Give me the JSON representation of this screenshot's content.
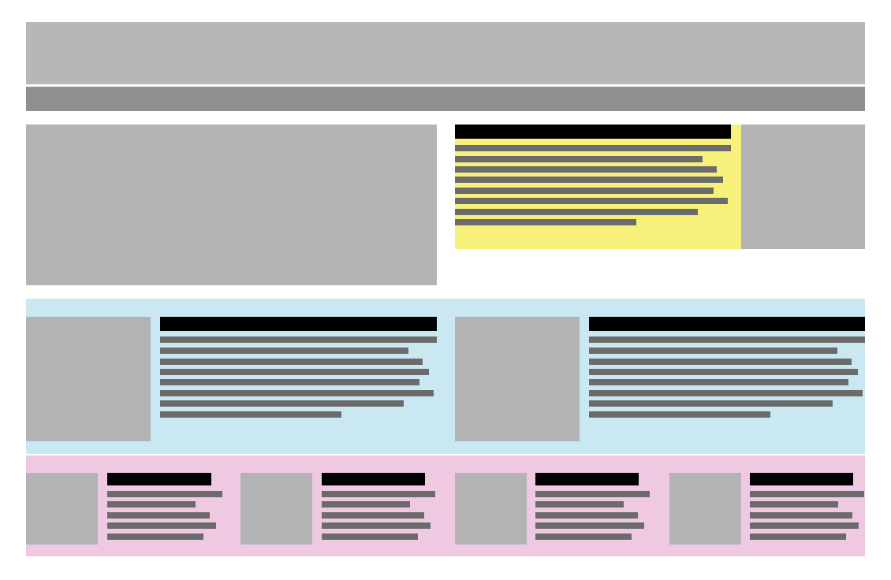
{
  "colors": {
    "canvas": "#ffffff",
    "header": "#b7b7ba",
    "nav_bar": "#8f8f92",
    "image_placeholder": "#b3b3b6",
    "feature_box": "#f7f07a",
    "secondary_band": "#c9e8f1",
    "tertiary_band": "#efc9e2",
    "headline_bar": "#000000",
    "text_line": "#6b6b6b"
  },
  "blocks": [
    {
      "name": "header-block",
      "color": "header"
    },
    {
      "name": "nav-bar",
      "color": "nav_bar"
    },
    {
      "name": "hero-image-placeholder",
      "color": "image_placeholder"
    },
    {
      "name": "feature-text-box",
      "color": "feature_box"
    },
    {
      "name": "feature-side-image-placeholder",
      "color": "image_placeholder"
    },
    {
      "name": "secondary-story-band",
      "color": "secondary_band"
    },
    {
      "name": "tertiary-story-band",
      "color": "tertiary_band"
    }
  ]
}
